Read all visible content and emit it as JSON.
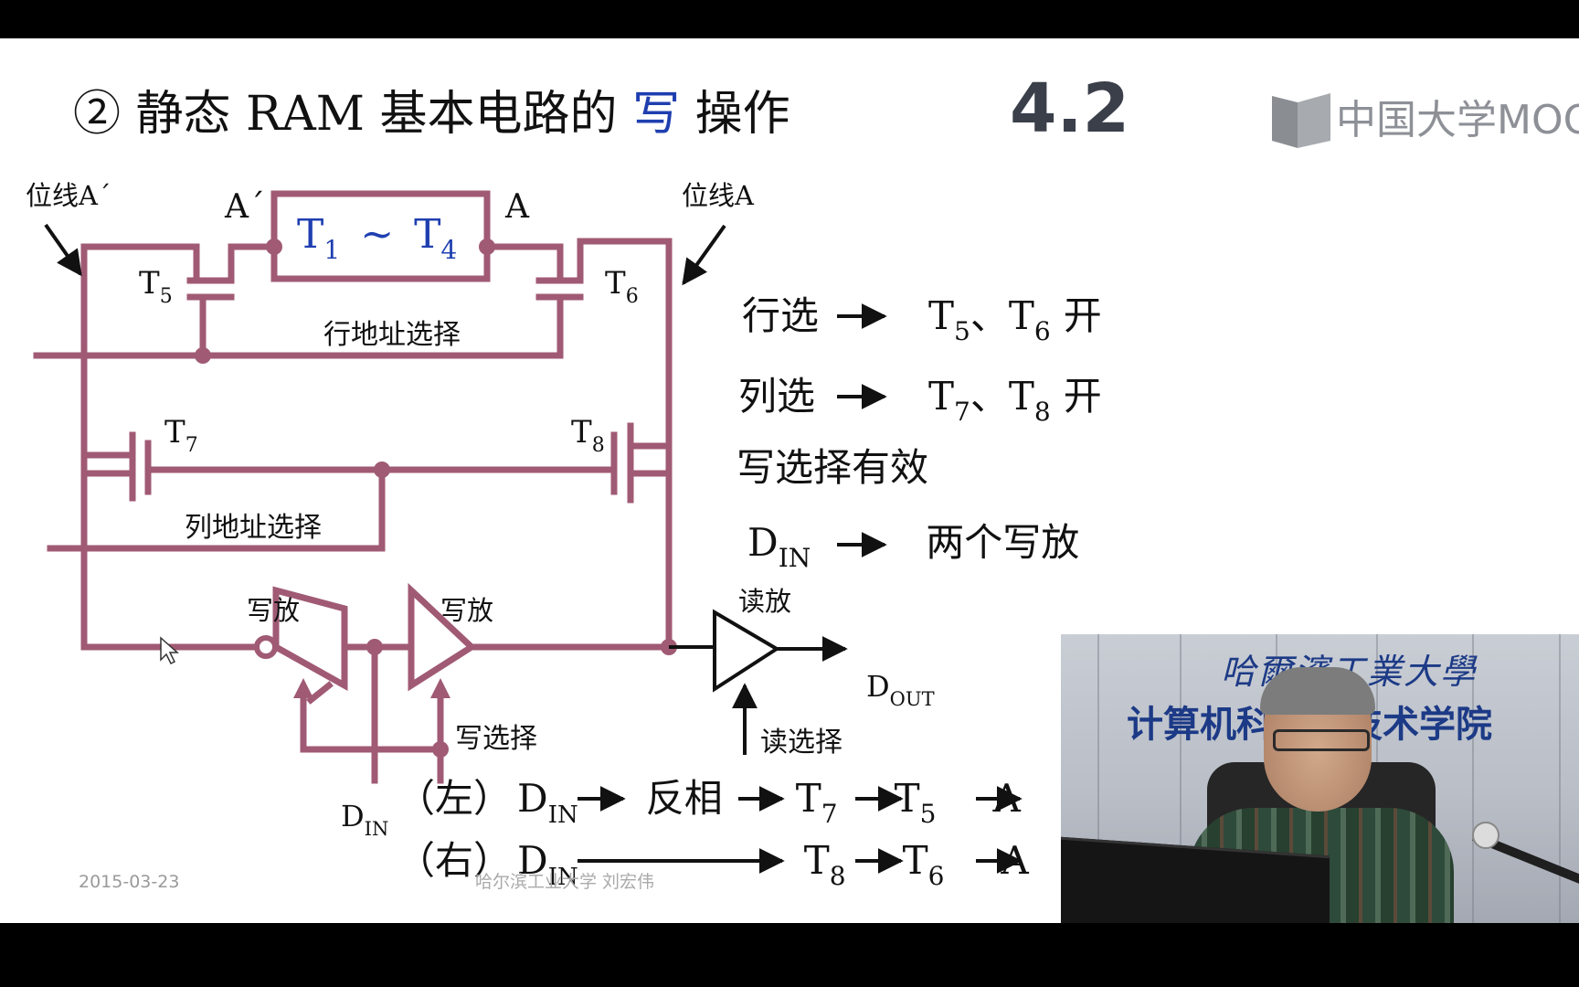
{
  "slide": {
    "title": {
      "prefix": "② 静态 RAM 基本电路的 ",
      "highlight": "写",
      "suffix": " 操作"
    },
    "section_number": "4.2",
    "logo_text": "中国大学MOOC",
    "date": "2015-03-23",
    "footer": "哈尔滨工业大学 刘宏伟",
    "colors": {
      "wire": "#a05a74",
      "highlight_text": "#1f3fb0",
      "text": "#111111"
    },
    "diagram": {
      "bitline_left": "位线A´",
      "bitline_right": "位线A",
      "node_left": "A´",
      "node_right": "A",
      "cell": {
        "T": "T",
        "sub1": "1",
        "tilde": "~",
        "sub2": "4"
      },
      "t5": {
        "T": "T",
        "sub": "5"
      },
      "t6": {
        "T": "T",
        "sub": "6"
      },
      "t7": {
        "T": "T",
        "sub": "7"
      },
      "t8": {
        "T": "T",
        "sub": "8"
      },
      "row_select": "行地址选择",
      "col_select": "列地址选择",
      "write_amp_left": "写放",
      "write_amp_right": "写放",
      "read_amp": "读放",
      "write_select": "写选择",
      "read_select": "读选择",
      "din": {
        "D": "D",
        "sub": "IN"
      },
      "dout": {
        "D": "D",
        "sub": "OUT"
      }
    },
    "notes": {
      "row": {
        "label": "行选",
        "a": "5",
        "b": "6",
        "sep": "、",
        "end": "开"
      },
      "col": {
        "label": "列选",
        "a": "7",
        "b": "8",
        "sep": "、",
        "end": "开"
      },
      "write_valid": "写选择有效",
      "din_line": {
        "D": "D",
        "sub": "IN",
        "text": "两个写放"
      }
    },
    "paths": {
      "left": {
        "tag": "（左）",
        "D": "D",
        "sub": "IN",
        "invert": "反相",
        "s1": "7",
        "s2": "5",
        "end": "A"
      },
      "right": {
        "tag": "（右）",
        "D": "D",
        "sub": "IN",
        "s1": "8",
        "s2": "6",
        "end": "A"
      }
    }
  },
  "video": {
    "banner_line1": "哈爾濱工業大學",
    "banner_line2": "计算机科学与技术学院"
  }
}
